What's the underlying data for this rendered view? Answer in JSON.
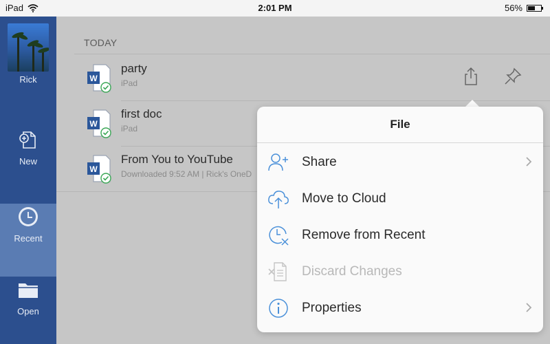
{
  "status_bar": {
    "device": "iPad",
    "time": "2:01 PM",
    "battery": "56%",
    "battery_level": 0.56
  },
  "sidebar": {
    "user_name": "Rick",
    "items": [
      {
        "label": "New",
        "icon": "new-document-icon"
      },
      {
        "label": "Recent",
        "icon": "clock-icon",
        "selected": true
      },
      {
        "label": "Open",
        "icon": "folder-icon"
      }
    ]
  },
  "main": {
    "section_header": "TODAY",
    "documents": [
      {
        "title": "party",
        "subtitle": "iPad"
      },
      {
        "title": "first doc",
        "subtitle": "iPad"
      },
      {
        "title": "From You to YouTube",
        "subtitle": "Downloaded 9:52 AM | Rick's OneD"
      }
    ]
  },
  "popover": {
    "title": "File",
    "items": [
      {
        "label": "Share",
        "icon": "add-person-icon",
        "chevron": true,
        "enabled": true
      },
      {
        "label": "Move to Cloud",
        "icon": "cloud-upload-icon",
        "chevron": false,
        "enabled": true
      },
      {
        "label": "Remove from Recent",
        "icon": "clock-remove-icon",
        "chevron": false,
        "enabled": true
      },
      {
        "label": "Discard Changes",
        "icon": "discard-icon",
        "chevron": false,
        "enabled": false
      },
      {
        "label": "Properties",
        "icon": "info-icon",
        "chevron": true,
        "enabled": true
      }
    ]
  },
  "colors": {
    "sidebar": "#2c4f8e",
    "sidebar_selected": "#5a7cb3",
    "word_blue": "#2b579a",
    "check_green": "#3aa655"
  }
}
